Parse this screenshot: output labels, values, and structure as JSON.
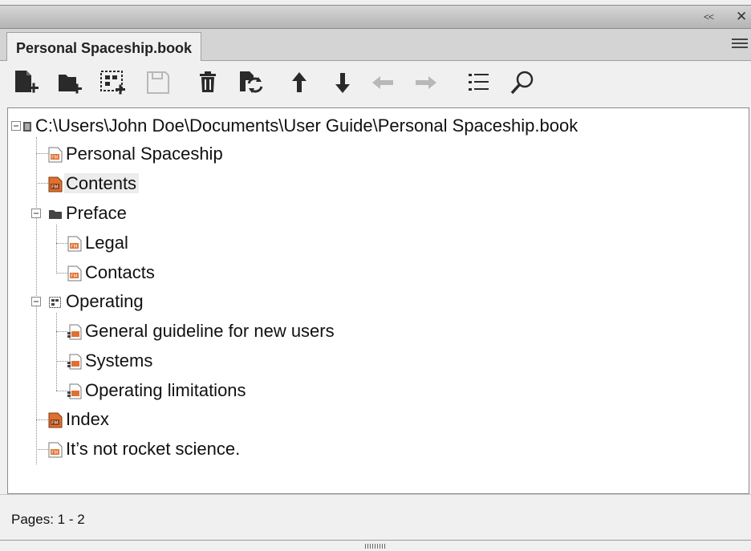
{
  "window": {
    "collapse_glyph": "<<",
    "close_glyph": "✕"
  },
  "tab": {
    "label": "Personal Spaceship.book"
  },
  "toolbar": [
    "add-file-icon",
    "add-folder-icon",
    "add-group-icon",
    "save-icon",
    "delete-icon",
    "update-book-icon",
    "move-up-icon",
    "move-down-icon",
    "move-left-icon",
    "move-right-icon",
    "numbering-icon",
    "find-icon"
  ],
  "tree": {
    "root": "C:\\Users\\John Doe\\Documents\\User Guide\\Personal Spaceship.book",
    "items": [
      {
        "label": "Personal Spaceship",
        "icon": "fm-file-icon"
      },
      {
        "label": "Contents",
        "icon": "fm-generated-file-icon",
        "selected": true
      },
      {
        "label": "Preface",
        "icon": "folder-icon"
      },
      {
        "label": "Legal",
        "icon": "fm-file-icon"
      },
      {
        "label": "Contacts",
        "icon": "fm-file-icon"
      },
      {
        "label": "Operating",
        "icon": "group-icon"
      },
      {
        "label": "General guideline for new users",
        "icon": "fm-group-file-icon"
      },
      {
        "label": "Systems",
        "icon": "fm-group-file-icon"
      },
      {
        "label": "Operating limitations",
        "icon": "fm-group-file-icon"
      },
      {
        "label": "Index",
        "icon": "fm-generated-file-icon"
      },
      {
        "label": "It’s not rocket science.",
        "icon": "fm-file-icon"
      }
    ]
  },
  "status": {
    "text": "Pages: 1 - 2"
  },
  "colors": {
    "fm_file": "#e07030",
    "toolbar_icon": "#2a2a2a",
    "disabled_icon": "#b8b8b8"
  }
}
